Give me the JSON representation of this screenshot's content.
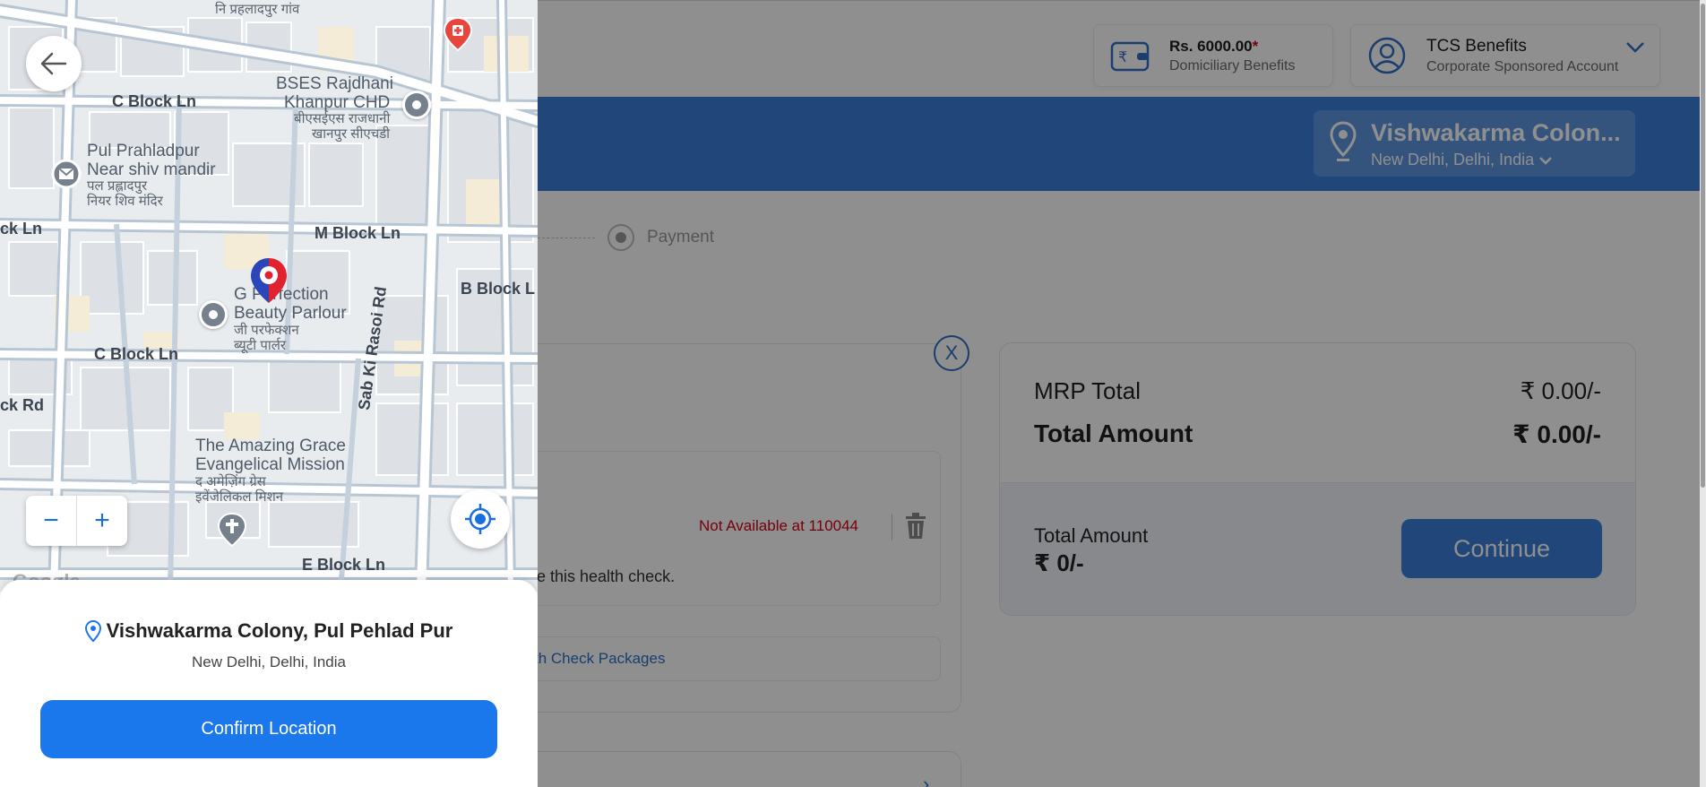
{
  "header": {
    "wallet": {
      "amount": "Rs. 6000.00",
      "required_mark": "*",
      "subtitle": "Domiciliary Benefits",
      "icon": "wallet-icon"
    },
    "account": {
      "title": "TCS Benefits",
      "subtitle": "Corporate Sponsored Account",
      "icon": "user-circle-icon"
    }
  },
  "location_bar": {
    "title": "Vishwakarma Colon...",
    "subtitle": "New Delhi, Delhi, India"
  },
  "stepper": {
    "step_label": "Payment"
  },
  "cart": {
    "close_symbol": "X",
    "availability": "Not Available at 110044",
    "health_check_text": "e this health check.",
    "packages_link": "th Check Packages"
  },
  "summary": {
    "mrp_label": "MRP Total",
    "mrp_value": "₹ 0.00/-",
    "total_label": "Total Amount",
    "total_value": "₹ 0.00/-",
    "footer_label": "Total Amount",
    "footer_value": "₹ 0/-",
    "continue_label": "Continue"
  },
  "map": {
    "labels": {
      "top_partial": "नि प्रहलादपुर गांव",
      "c_block_top": "C Block Ln",
      "bses_1": "BSES Rajdhani",
      "bses_2": "Khanpur CHD",
      "bses_hi_1": "बीएसईएस राजधानी",
      "bses_hi_2": "खानपुर सीएचडी",
      "pul_1": "Pul Prahladpur",
      "pul_2": "Near shiv mandir",
      "pul_hi_1": "पल प्रह्लादपुर",
      "pul_hi_2": "नियर शिव मंदिर",
      "ck_ln": "ck Ln",
      "m_block": "M Block Ln",
      "b_block": "B Block L",
      "g_perf_1": "G Perfection",
      "g_perf_2": "Beauty Parlour",
      "g_perf_hi_1": "जी परफेक्शन",
      "g_perf_hi_2": "ब्यूटी पार्लर",
      "c_block_mid": "C Block Ln",
      "ck_rd": "ck Rd",
      "sab_ki_rasoi": "Sab Ki Rasoi Rd",
      "grace_1": "The Amazing Grace",
      "grace_2": "Evangelical Mission",
      "grace_hi_1": "द अमेज़िंग ग्रेस",
      "grace_hi_2": "इवेंजेलिकल मिशन",
      "e_block": "E Block Ln",
      "google": "Google"
    },
    "zoom_out": "−",
    "zoom_in": "+"
  },
  "sheet": {
    "address": "Vishwakarma Colony, Pul Pehlad Pur",
    "sub_address": "New Delhi, Delhi, India",
    "confirm_label": "Confirm Location"
  },
  "colors": {
    "brand_blue": "#1a77ec",
    "band_blue": "#3b7fd9",
    "error_red": "#d0021b",
    "pin_red": "#e0232e",
    "pin_blue": "#2a46b8"
  }
}
